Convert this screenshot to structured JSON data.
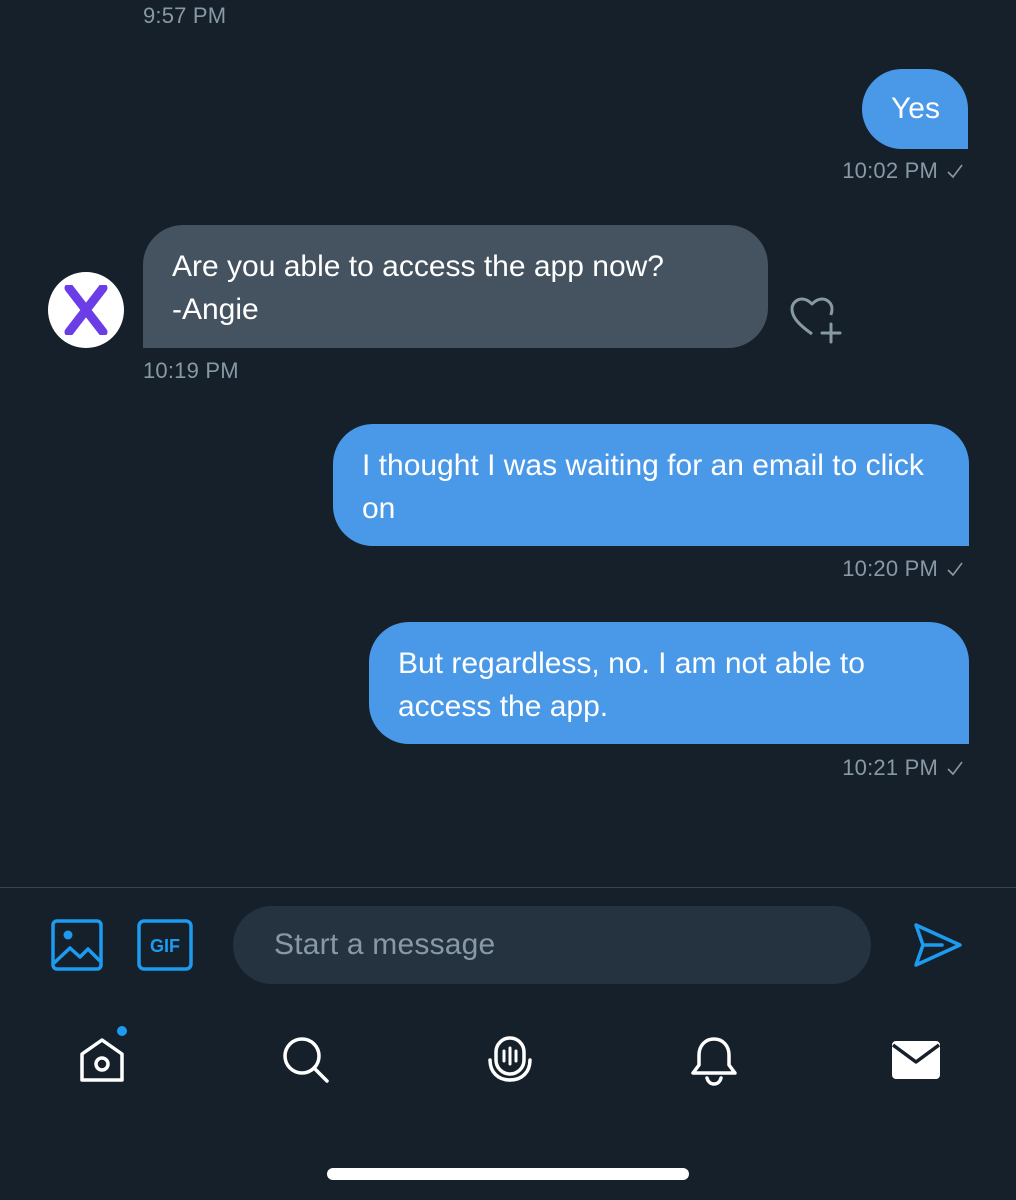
{
  "conversation": {
    "messages": [
      {
        "direction": "in",
        "time": "9:57 PM"
      },
      {
        "direction": "out",
        "text": "Yes",
        "time": "10:02 PM"
      },
      {
        "direction": "in",
        "text": "Are you able to access the app now?\n-Angie",
        "time": "10:19 PM",
        "avatar_letter": "X"
      },
      {
        "direction": "out",
        "text": "I thought I was waiting for an email to click on",
        "time": "10:20 PM"
      },
      {
        "direction": "out",
        "text": "But regardless, no. I am not able to access the app.",
        "time": "10:21 PM"
      }
    ]
  },
  "composer": {
    "placeholder": "Start a message",
    "gif_label": "GIF",
    "icons": [
      "image-icon",
      "gif-icon",
      "send-icon"
    ]
  },
  "bottom_nav": {
    "items": [
      "home",
      "search",
      "spaces",
      "notifications",
      "messages"
    ],
    "active": "messages",
    "home_has_badge": true
  },
  "colors": {
    "background": "#15202b",
    "outgoing_bubble": "#4a99e9",
    "incoming_bubble": "#455361",
    "accent": "#1d9bf0",
    "muted_text": "#8899a6",
    "avatar_letter": "#6b3de6"
  }
}
